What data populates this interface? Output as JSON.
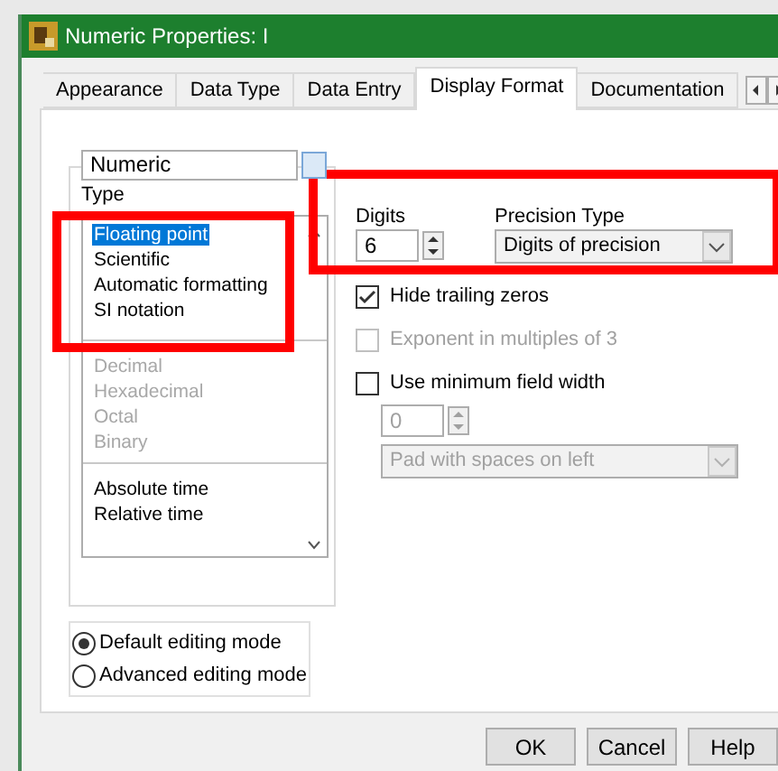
{
  "window": {
    "title": "Numeric Properties: I"
  },
  "tabs": [
    {
      "label": "Appearance",
      "selected": false
    },
    {
      "label": "Data Type",
      "selected": false
    },
    {
      "label": "Data Entry",
      "selected": false
    },
    {
      "label": "Display Format",
      "selected": true
    },
    {
      "label": "Documentation",
      "selected": false
    }
  ],
  "object_selector": {
    "value": "Numeric"
  },
  "type_list": {
    "label": "Type",
    "groups": [
      [
        {
          "label": "Floating point",
          "selected": true,
          "disabled": false
        },
        {
          "label": "Scientific",
          "selected": false,
          "disabled": false
        },
        {
          "label": "Automatic formatting",
          "selected": false,
          "disabled": false
        },
        {
          "label": "SI notation",
          "selected": false,
          "disabled": false
        }
      ],
      [
        {
          "label": "Decimal",
          "selected": false,
          "disabled": true
        },
        {
          "label": "Hexadecimal",
          "selected": false,
          "disabled": true
        },
        {
          "label": "Octal",
          "selected": false,
          "disabled": true
        },
        {
          "label": "Binary",
          "selected": false,
          "disabled": true
        }
      ],
      [
        {
          "label": "Absolute time",
          "selected": false,
          "disabled": false
        },
        {
          "label": "Relative time",
          "selected": false,
          "disabled": false
        }
      ]
    ]
  },
  "digits": {
    "label": "Digits",
    "value": "6"
  },
  "precision_type": {
    "label": "Precision Type",
    "value": "Digits of precision"
  },
  "options": [
    {
      "label": "Hide trailing zeros",
      "checked": true,
      "disabled": false
    },
    {
      "label": "Exponent in multiples of 3",
      "checked": false,
      "disabled": true
    },
    {
      "label": "Use minimum field width",
      "checked": false,
      "disabled": false
    }
  ],
  "min_width": {
    "value": "0",
    "disabled": true
  },
  "padding": {
    "value": "Pad with spaces on left",
    "disabled": true
  },
  "editing_modes": [
    {
      "label": "Default editing mode",
      "selected": true
    },
    {
      "label": "Advanced editing mode",
      "selected": false
    }
  ],
  "buttons": [
    "OK",
    "Cancel",
    "Help"
  ]
}
